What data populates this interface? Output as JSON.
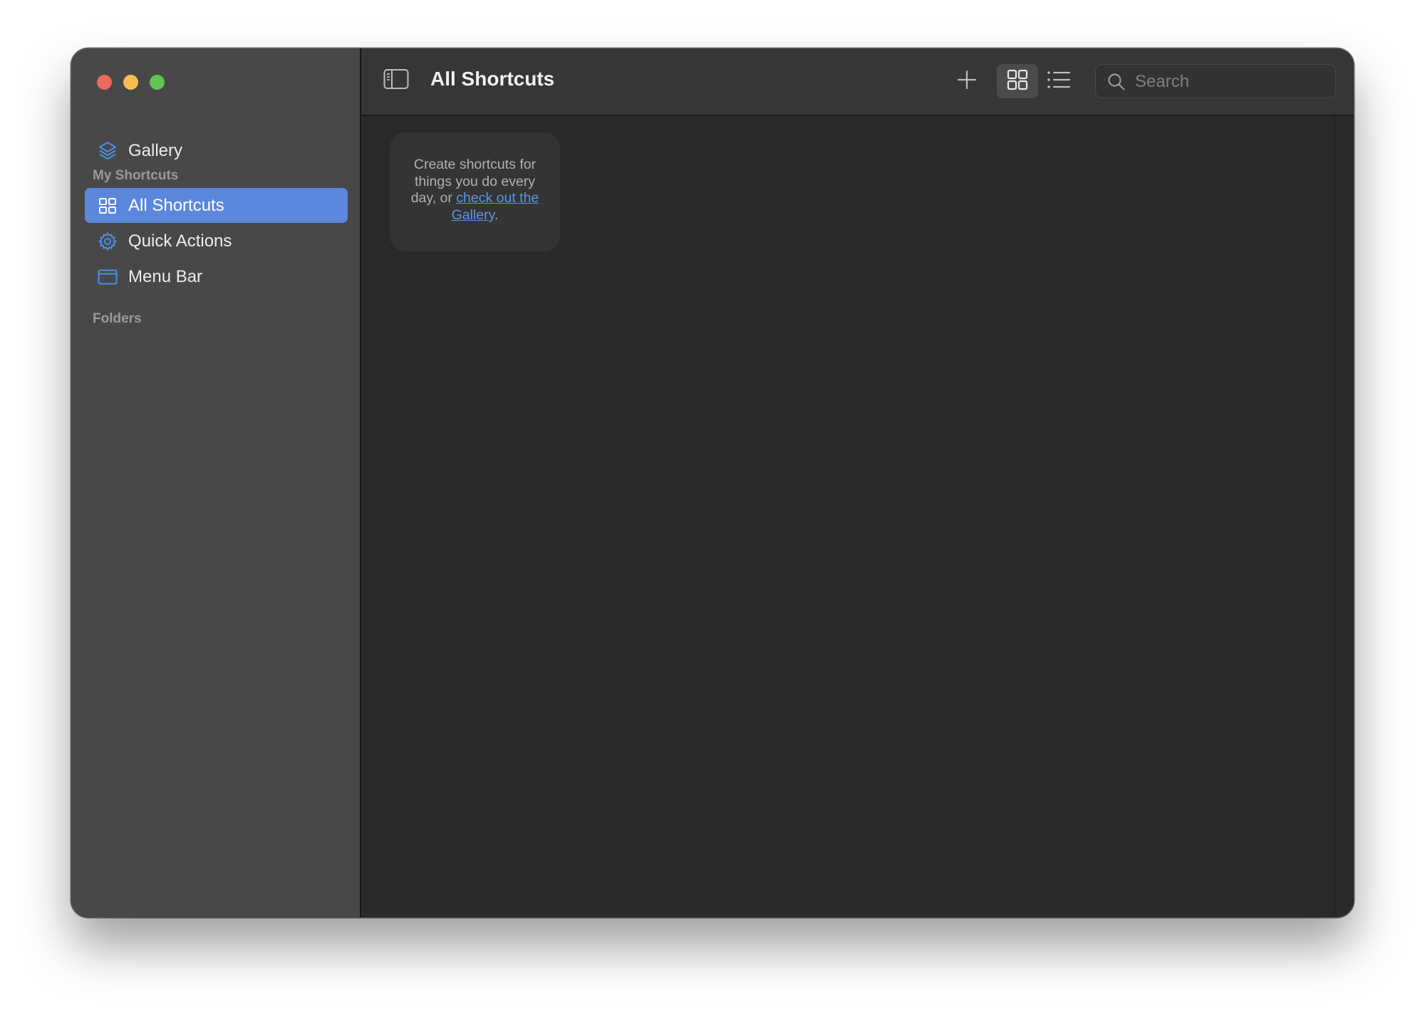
{
  "window": {
    "title": "All Shortcuts"
  },
  "sidebar": {
    "gallery_label": "Gallery",
    "section_my_shortcuts": "My Shortcuts",
    "items": [
      {
        "label": "All Shortcuts",
        "icon": "grid-icon",
        "selected": true
      },
      {
        "label": "Quick Actions",
        "icon": "gear-icon",
        "selected": false
      },
      {
        "label": "Menu Bar",
        "icon": "menubar-window-icon",
        "selected": false
      }
    ],
    "section_folders": "Folders"
  },
  "toolbar": {
    "title": "All Shortcuts",
    "add_icon": "plus-icon",
    "grid_view_icon": "grid-view-icon",
    "list_view_icon": "list-view-icon",
    "active_view": "grid"
  },
  "search": {
    "placeholder": "Search",
    "value": ""
  },
  "empty_state": {
    "text_before": "Create shortcuts for things you do every day, or ",
    "link_text": "check out the Gallery",
    "text_after": "."
  },
  "colors": {
    "accent": "#5b87dc",
    "link": "#5c95ee",
    "icon_blue": "#4a90e8",
    "sidebar_bg": "#484848",
    "content_bg": "#292a2a",
    "toolbar_bg": "#353636"
  }
}
